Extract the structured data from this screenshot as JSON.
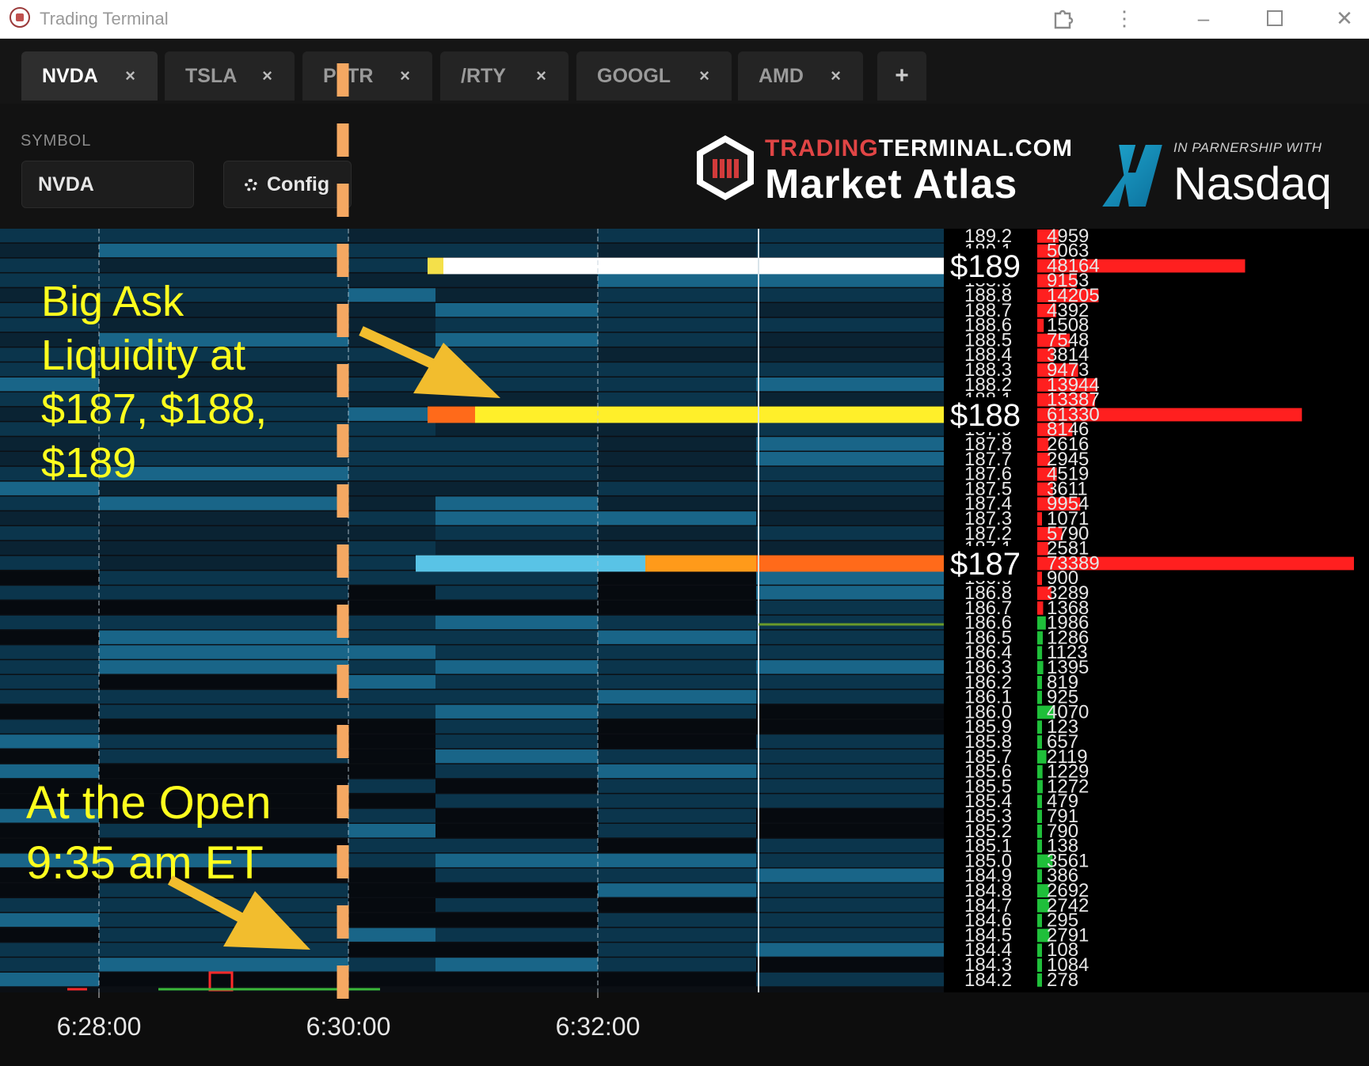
{
  "window": {
    "title": "Trading Terminal"
  },
  "tabs": [
    {
      "label": "NVDA",
      "close": "×",
      "active": true
    },
    {
      "label": "TSLA",
      "close": "×",
      "active": false
    },
    {
      "label": "PLTR",
      "close": "×",
      "active": false
    },
    {
      "label": "/RTY",
      "close": "×",
      "active": false
    },
    {
      "label": "GOOGL",
      "close": "×",
      "active": false
    },
    {
      "label": "AMD",
      "close": "×",
      "active": false
    }
  ],
  "tab_add_label": "+",
  "toolbar": {
    "symbol_label": "SYMBOL",
    "symbol_value": "NVDA",
    "config_label": "Config"
  },
  "brand": {
    "line1_red": "TRADING",
    "line1_white": "TERMINAL.COM",
    "line2": "Market Atlas"
  },
  "partner": {
    "small": "IN PARNERSHIP WITH",
    "big": "Nasdaq"
  },
  "chart_data": {
    "type": "heatmap",
    "x_ticks": [
      "6:28:00",
      "6:30:00",
      "6:32:00"
    ],
    "price_levels": [
      189.2,
      189.1,
      189.0,
      188.9,
      188.8,
      188.7,
      188.6,
      188.5,
      188.4,
      188.3,
      188.2,
      188.1,
      188.0,
      187.9,
      187.8,
      187.7,
      187.6,
      187.5,
      187.4,
      187.3,
      187.2,
      187.1,
      187.0,
      186.9,
      186.8,
      186.7,
      186.6,
      186.5,
      186.4,
      186.3,
      186.2,
      186.1,
      186.0,
      185.9,
      185.8,
      185.7,
      185.6,
      185.5,
      185.4,
      185.3,
      185.2,
      185.1,
      185.0,
      184.9,
      184.8,
      184.7,
      184.6,
      184.5,
      184.4,
      184.3,
      184.2
    ],
    "price_labels": [
      "189.2",
      "189.1",
      "189.0",
      "188.9",
      "188.8",
      "188.7",
      "188.6",
      "188.5",
      "188.4",
      "188.3",
      "188.2",
      "188.1",
      "188.0",
      "187.9",
      "187.8",
      "187.7",
      "187.6",
      "187.5",
      "187.4",
      "187.3",
      "187.2",
      "187.1",
      "187.0",
      "186.9",
      "186.8",
      "186.7",
      "186.6",
      "186.5",
      "186.4",
      "186.3",
      "186.2",
      "186.1",
      "186.0",
      "185.9",
      "185.8",
      "185.7",
      "185.6",
      "185.5",
      "185.4",
      "185.3",
      "185.2",
      "185.1",
      "185.0",
      "184.9",
      "184.8",
      "184.7",
      "184.6",
      "184.5",
      "184.4",
      "184.3",
      "184.2"
    ],
    "sizes": [
      4959,
      5063,
      48164,
      9153,
      14205,
      4392,
      1508,
      7548,
      3814,
      9473,
      13944,
      13387,
      61330,
      8146,
      2616,
      2945,
      4519,
      3611,
      9954,
      1071,
      5790,
      2581,
      73389,
      900,
      3289,
      1368,
      1986,
      1286,
      1123,
      1395,
      819,
      925,
      4070,
      123,
      657,
      2119,
      1229,
      1272,
      479,
      791,
      790,
      138,
      3561,
      386,
      2692,
      2742,
      295,
      2791,
      108,
      1084,
      278
    ],
    "side": [
      "ask",
      "ask",
      "ask",
      "ask",
      "ask",
      "ask",
      "ask",
      "ask",
      "ask",
      "ask",
      "ask",
      "ask",
      "ask",
      "ask",
      "ask",
      "ask",
      "ask",
      "ask",
      "ask",
      "ask",
      "ask",
      "ask",
      "ask",
      "ask",
      "ask",
      "ask",
      "bid",
      "bid",
      "bid",
      "bid",
      "bid",
      "bid",
      "bid",
      "bid",
      "bid",
      "bid",
      "bid",
      "bid",
      "bid",
      "bid",
      "bid",
      "bid",
      "bid",
      "bid",
      "bid",
      "bid",
      "bid",
      "bid",
      "bid",
      "bid",
      "bid"
    ],
    "highlights": [
      {
        "label": "$189",
        "price": 189.0
      },
      {
        "label": "$188",
        "price": 188.0
      },
      {
        "label": "$187",
        "price": 187.0
      }
    ],
    "colors": {
      "ask_bar": "#ff1f1f",
      "bid_bar": "#1fbf3a",
      "heat_low": "#0b3a52",
      "heat_mid": "#1b6f95",
      "heat_high_white": "#ffffff",
      "heat_high_yellow": "#ffef2a",
      "heat_high_orange": "#ff6a1a"
    }
  },
  "annotations": {
    "left_top": [
      "Big Ask",
      "Liquidity at",
      "$187, $188,",
      "$189"
    ],
    "left_bottom": [
      "At the Open",
      "9:35 am ET"
    ],
    "color": "#ffff1e",
    "marker_color": "#f5a862",
    "arrow_color": "#f2bd2e"
  }
}
